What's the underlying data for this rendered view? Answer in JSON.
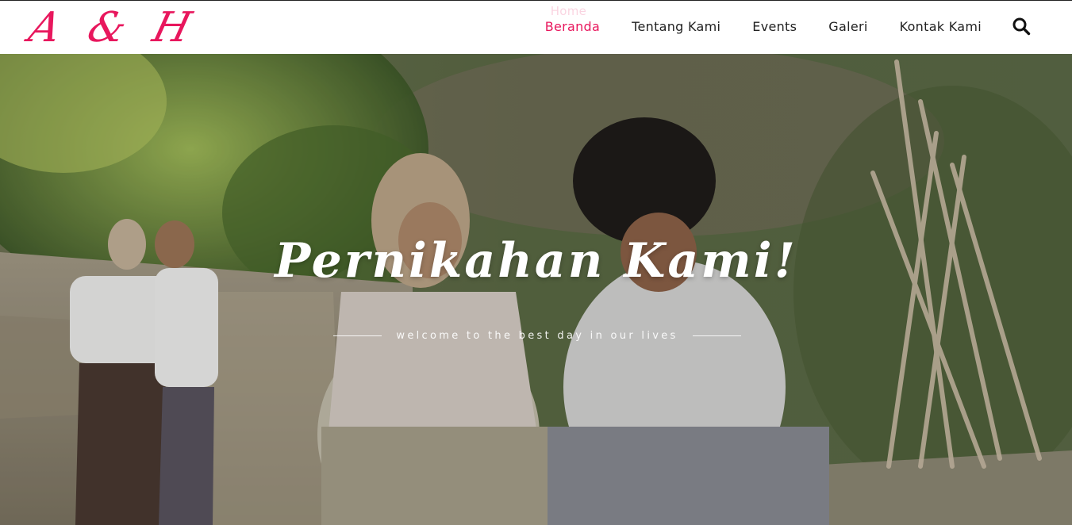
{
  "brand": {
    "logo_letters": [
      "A",
      "&",
      "H"
    ],
    "color": "#e8175d"
  },
  "nav": {
    "ghost_label": "Home",
    "items": [
      {
        "label": "Beranda",
        "active": true
      },
      {
        "label": "Tentang Kami",
        "active": false
      },
      {
        "label": "Events",
        "active": false
      },
      {
        "label": "Galeri",
        "active": false
      },
      {
        "label": "Kontak Kami",
        "active": false
      }
    ],
    "search_icon": "search-icon"
  },
  "hero": {
    "title": "Pernikahan Kami!",
    "subtitle": "welcome to the best day in our lives"
  }
}
